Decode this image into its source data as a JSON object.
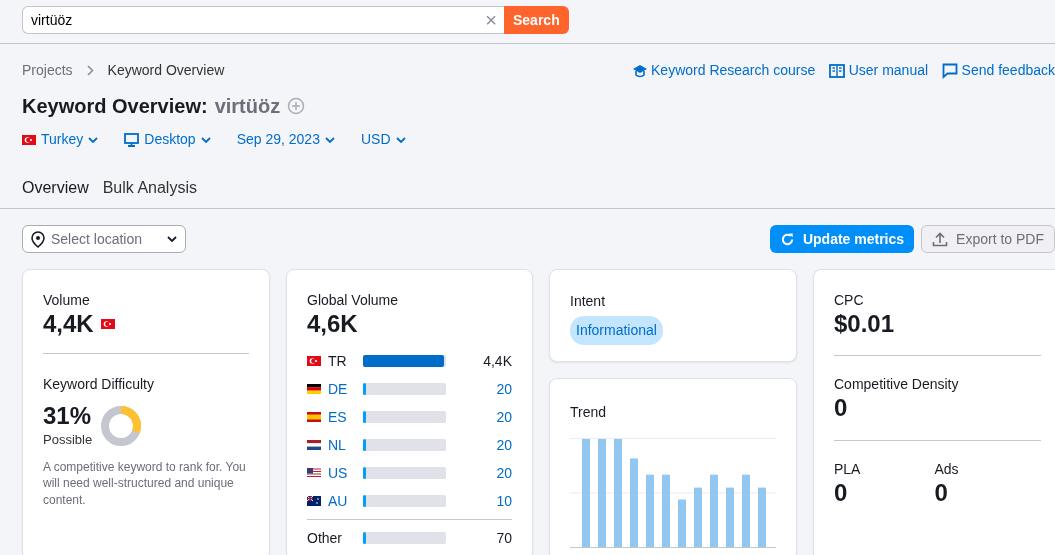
{
  "search": {
    "value": "virtüöz",
    "clear": "×",
    "button": "Search"
  },
  "breadcrumbs": [
    "Projects",
    "Keyword Overview"
  ],
  "help_links": [
    {
      "label": "Keyword Research course",
      "kind": "course"
    },
    {
      "label": "User manual",
      "kind": "manual"
    },
    {
      "label": "Send feedback",
      "kind": "feedback"
    }
  ],
  "title": {
    "label": "Keyword Overview:",
    "keyword": "virtüöz"
  },
  "filters": [
    {
      "label": "Turkey",
      "kind": "flag"
    },
    {
      "label": "Desktop",
      "kind": "desktop"
    },
    {
      "label": "Sep 29, 2023",
      "kind": "plain"
    },
    {
      "label": "USD",
      "kind": "plain"
    }
  ],
  "tabs": [
    {
      "label": "Overview",
      "selected": true
    },
    {
      "label": "Bulk Analysis",
      "selected": false
    }
  ],
  "location": {
    "placeholder": "Select location"
  },
  "actions": {
    "update": "Update metrics",
    "export": "Export to PDF"
  },
  "volume": {
    "label": "Volume",
    "value": "4,4K"
  },
  "difficulty": {
    "label": "Keyword Difficulty",
    "value": "31%",
    "rating": "Possible",
    "note": "A competitive keyword to rank for. You will need well-structured and unique content."
  },
  "global_volume": {
    "label": "Global Volume",
    "value": "4,6K",
    "rows": [
      {
        "code": "TR",
        "value": "4,4K",
        "linked": false,
        "level": 0.97
      },
      {
        "code": "DE",
        "value": "20",
        "linked": true,
        "level": 0.03
      },
      {
        "code": "ES",
        "value": "20",
        "linked": true,
        "level": 0.03
      },
      {
        "code": "NL",
        "value": "20",
        "linked": true,
        "level": 0.03
      },
      {
        "code": "US",
        "value": "20",
        "linked": true,
        "level": 0.03
      },
      {
        "code": "AU",
        "value": "10",
        "linked": true,
        "level": 0.03
      }
    ],
    "other": {
      "code": "Other",
      "value": "70",
      "level": 0.03
    }
  },
  "intent": {
    "label": "Intent",
    "tag": "Informational"
  },
  "trend": {
    "label": "Trend"
  },
  "cpc": {
    "label": "CPC",
    "value": "$0.01"
  },
  "density": {
    "label": "Competitive Density",
    "value": "0"
  },
  "pla": {
    "label": "PLA",
    "value": "0"
  },
  "ads": {
    "label": "Ads",
    "value": "0"
  }
}
